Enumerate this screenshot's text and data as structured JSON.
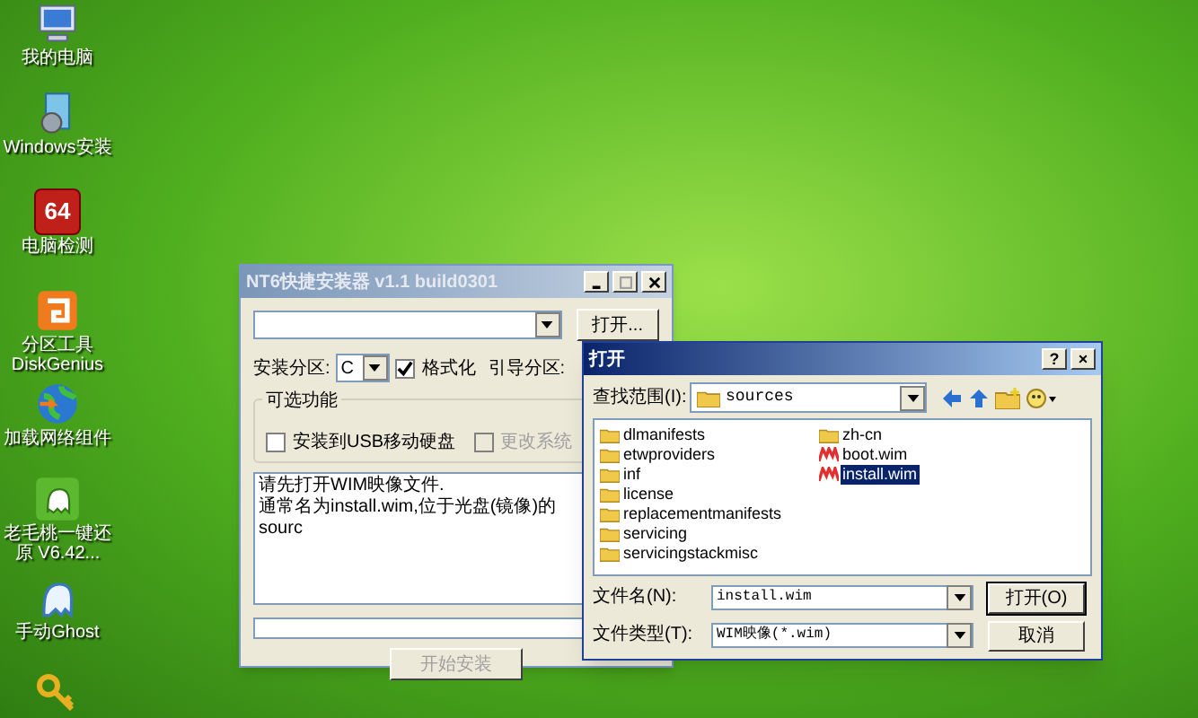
{
  "desktop_icons": [
    {
      "kind": "computer",
      "label": "我的电脑"
    },
    {
      "kind": "setup",
      "label": "Windows安装"
    },
    {
      "kind": "benchmark",
      "badge": "64",
      "label": "电脑检测"
    },
    {
      "kind": "partition",
      "label": "分区工具 DiskGenius"
    },
    {
      "kind": "globe",
      "label": "加载网络组件"
    },
    {
      "kind": "ghost-green",
      "label": "老毛桃一键还原 V6.42..."
    },
    {
      "kind": "ghost",
      "label": "手动Ghost"
    },
    {
      "kind": "key"
    }
  ],
  "installer_window": {
    "title": "NT6快捷安装器 v1.1 build0301",
    "active": false,
    "open_button": "打开...",
    "partition_label": "安装分区:",
    "partition_value": "C",
    "format_checkbox": {
      "label": "格式化",
      "checked": true,
      "disabled": false
    },
    "boot_label": "引导分区:",
    "group_title": "可选功能",
    "options": [
      {
        "label": "安装到USB移动硬盘",
        "checked": false,
        "disabled": false
      },
      {
        "label": "更改系统",
        "checked": false,
        "disabled": true
      }
    ],
    "message_lines": [
      "请先打开WIM映像文件.",
      "通常名为install.wim,位于光盘(镜像)的sourc"
    ],
    "progress": {
      "level": 0
    },
    "start_button": {
      "label": "开始安装",
      "disabled": true
    }
  },
  "open_dialog": {
    "title": "打开",
    "active": true,
    "help_button": "?",
    "close_button": "×",
    "look_in_label": "查找范围(I):",
    "look_in_value": "sources",
    "files": [
      {
        "name": "dlmanifests",
        "kind": "folder",
        "selected": false
      },
      {
        "name": "etwproviders",
        "kind": "folder",
        "selected": false
      },
      {
        "name": "inf",
        "kind": "folder",
        "selected": false
      },
      {
        "name": "license",
        "kind": "folder",
        "selected": false
      },
      {
        "name": "replacementmanifests",
        "kind": "folder",
        "selected": false
      },
      {
        "name": "servicing",
        "kind": "folder",
        "selected": false
      },
      {
        "name": "servicingstackmisc",
        "kind": "folder",
        "selected": false
      },
      {
        "name": "zh-cn",
        "kind": "folder",
        "selected": false
      },
      {
        "name": "boot.wim",
        "kind": "wim",
        "selected": false
      },
      {
        "name": "install.wim",
        "kind": "wim",
        "selected": true
      }
    ],
    "filename_label": "文件名(N):",
    "filename_value": "install.wim",
    "filetype_label": "文件类型(T):",
    "filetype_value": "WIM映像(*.wim)",
    "open_button": "打开(O)",
    "cancel_button": "取消"
  }
}
